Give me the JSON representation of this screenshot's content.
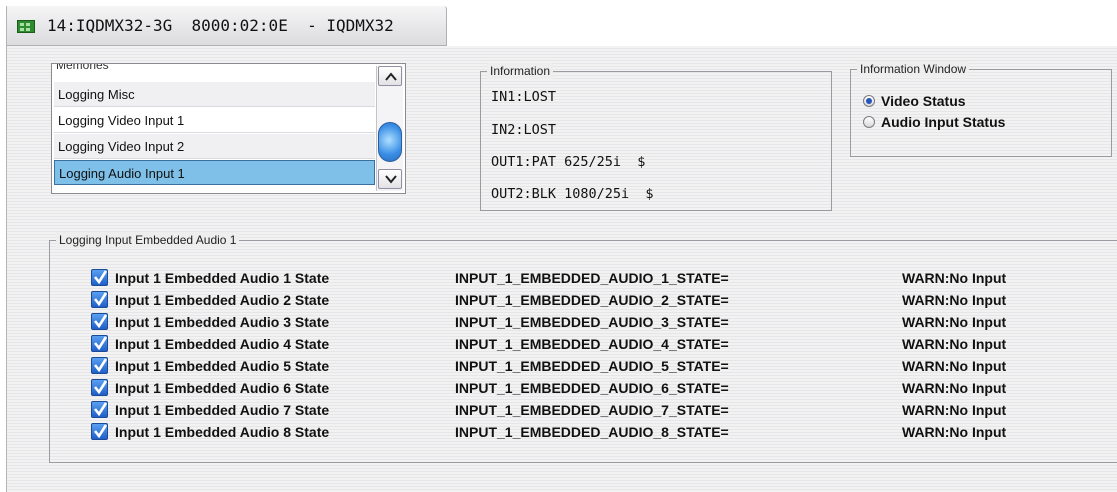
{
  "window": {
    "title": "14:IQDMX32-3G  8000:02:0E  - IQDMX32"
  },
  "memories": {
    "legend": "Memories",
    "items": [
      {
        "label": "Logging Misc",
        "selected": false
      },
      {
        "label": "Logging Video Input 1",
        "selected": false
      },
      {
        "label": "Logging Video Input 2",
        "selected": false
      },
      {
        "label": "Logging Audio Input 1",
        "selected": true
      }
    ]
  },
  "information": {
    "legend": "Information",
    "lines": [
      "IN1:LOST",
      "IN2:LOST",
      "OUT1:PAT 625/25i  $",
      "OUT2:BLK 1080/25i  $"
    ]
  },
  "info_window": {
    "legend": "Information Window",
    "options": [
      {
        "label": "Video Status",
        "selected": true
      },
      {
        "label": "Audio Input Status",
        "selected": false
      }
    ]
  },
  "logging": {
    "legend": "Logging Input Embedded Audio 1",
    "rows": [
      {
        "label": "Input 1 Embedded Audio 1 State",
        "key": "INPUT_1_EMBEDDED_AUDIO_1_STATE=",
        "value": "WARN:No Input",
        "checked": true
      },
      {
        "label": "Input 1 Embedded Audio 2 State",
        "key": "INPUT_1_EMBEDDED_AUDIO_2_STATE=",
        "value": "WARN:No Input",
        "checked": true
      },
      {
        "label": "Input 1 Embedded Audio 3 State",
        "key": "INPUT_1_EMBEDDED_AUDIO_3_STATE=",
        "value": "WARN:No Input",
        "checked": true
      },
      {
        "label": "Input 1 Embedded Audio 4 State",
        "key": "INPUT_1_EMBEDDED_AUDIO_4_STATE=",
        "value": "WARN:No Input",
        "checked": true
      },
      {
        "label": "Input 1 Embedded Audio 5 State",
        "key": "INPUT_1_EMBEDDED_AUDIO_5_STATE=",
        "value": "WARN:No Input",
        "checked": true
      },
      {
        "label": "Input 1 Embedded Audio 6 State",
        "key": "INPUT_1_EMBEDDED_AUDIO_6_STATE=",
        "value": "WARN:No Input",
        "checked": true
      },
      {
        "label": "Input 1 Embedded Audio 7 State",
        "key": "INPUT_1_EMBEDDED_AUDIO_7_STATE=",
        "value": "WARN:No Input",
        "checked": true
      },
      {
        "label": "Input 1 Embedded Audio 8 State",
        "key": "INPUT_1_EMBEDDED_AUDIO_8_STATE=",
        "value": "WARN:No Input",
        "checked": true
      }
    ]
  }
}
